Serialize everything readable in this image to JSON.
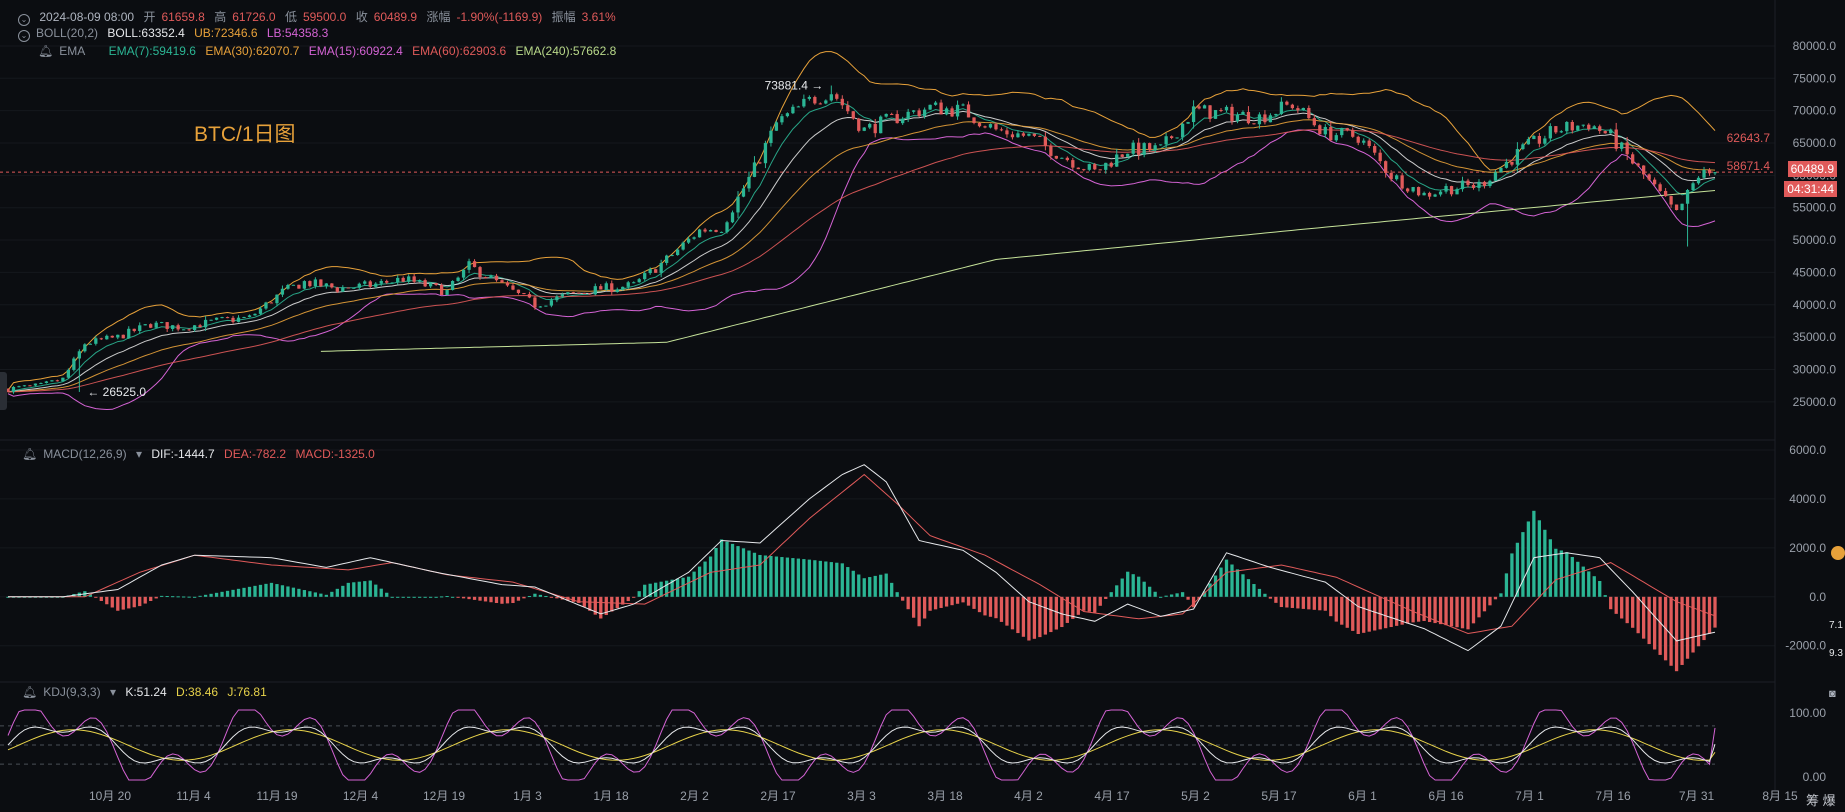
{
  "header": {
    "date": "2024-08-09 08:00",
    "open_label": "开",
    "open": "61659.8",
    "high_label": "高",
    "high": "61726.0",
    "low_label": "低",
    "low": "59500.0",
    "close_label": "收",
    "close": "60489.9",
    "change_label": "涨幅",
    "change": "-1.90%(-1169.9)",
    "amp_label": "振幅",
    "amp": "3.61%"
  },
  "boll": {
    "name": "BOLL(20,2)",
    "mid": "BOLL:63352.4",
    "ub": "UB:72346.6",
    "lb": "LB:54358.3"
  },
  "ema": {
    "name": "EMA",
    "e7": "EMA(7):59419.6",
    "e30": "EMA(30):62070.7",
    "e15": "EMA(15):60922.4",
    "e60": "EMA(60):62903.6",
    "e240": "EMA(240):57662.8"
  },
  "macd": {
    "name": "MACD(12,26,9)",
    "dif": "DIF:-1444.7",
    "dea": "DEA:-782.2",
    "macd": "MACD:-1325.0"
  },
  "kdj": {
    "name": "KDJ(9,3,3)",
    "k": "K:51.24",
    "d": "D:38.46",
    "j": "J:76.81"
  },
  "watermark": "BTC/1日图",
  "price_tags": {
    "ub": "62643.7",
    "lb": "58671.4",
    "last": "60489.9",
    "countdown": "04:31:44"
  },
  "annotations": {
    "high": "73881.4",
    "low": "26525.0"
  },
  "right_edge": {
    "m1": "7.1",
    "m2": "9.3",
    "foot": "筹 爆"
  },
  "colors": {
    "up": "#e05a5a",
    "down": "#2bb594",
    "boll_upper": "#e7a13a",
    "boll_lower": "#d463d4",
    "ema7": "#2bb594",
    "ema15": "#e0e0e0",
    "ema30": "#e7a13a",
    "ema60": "#e05a5a",
    "ema240": "#c6e39a",
    "dif": "#e6e8eb",
    "dea": "#e05a5a",
    "k": "#e6e8eb",
    "d": "#e7d24a",
    "j": "#d463d4"
  },
  "chart_data": [
    {
      "type": "candlestick",
      "title": "BTC/1日图",
      "x_ticks": [
        "10月 20",
        "11月 4",
        "11月 19",
        "12月 4",
        "12月 19",
        "1月 3",
        "1月 18",
        "2月 2",
        "2月 17",
        "3月 3",
        "3月 18",
        "4月 2",
        "4月 17",
        "5月 2",
        "5月 17",
        "6月 1",
        "6月 16",
        "7月 1",
        "7月 16",
        "7月 31",
        "8月 15"
      ],
      "y_ticks": [
        25000,
        30000,
        35000,
        40000,
        45000,
        50000,
        55000,
        60000,
        65000,
        70000,
        75000,
        80000
      ],
      "ylim": [
        22500,
        82000
      ],
      "price_path": [
        [
          0,
          27000
        ],
        [
          6,
          27500
        ],
        [
          10,
          28500
        ],
        [
          14,
          34000
        ],
        [
          20,
          35000
        ],
        [
          26,
          37000
        ],
        [
          32,
          36500
        ],
        [
          38,
          37500
        ],
        [
          44,
          38000
        ],
        [
          50,
          42000
        ],
        [
          54,
          43500
        ],
        [
          60,
          42500
        ],
        [
          66,
          43000
        ],
        [
          72,
          44000
        ],
        [
          80,
          42000
        ],
        [
          84,
          46000
        ],
        [
          90,
          43000
        ],
        [
          96,
          40000
        ],
        [
          102,
          41500
        ],
        [
          108,
          42500
        ],
        [
          114,
          43000
        ],
        [
          120,
          47000
        ],
        [
          126,
          51500
        ],
        [
          130,
          52000
        ],
        [
          136,
          61000
        ],
        [
          140,
          68000
        ],
        [
          146,
          71500
        ],
        [
          150,
          73000
        ],
        [
          156,
          67000
        ],
        [
          162,
          69000
        ],
        [
          168,
          70500
        ],
        [
          174,
          70000
        ],
        [
          180,
          67000
        ],
        [
          186,
          66000
        ],
        [
          192,
          63000
        ],
        [
          198,
          60500
        ],
        [
          204,
          64000
        ],
        [
          210,
          64000
        ],
        [
          216,
          70000
        ],
        [
          222,
          69500
        ],
        [
          228,
          69000
        ],
        [
          234,
          71000
        ],
        [
          240,
          66500
        ],
        [
          246,
          66000
        ],
        [
          252,
          60000
        ],
        [
          258,
          57000
        ],
        [
          262,
          58000
        ],
        [
          268,
          58500
        ],
        [
          276,
          64000
        ],
        [
          282,
          67000
        ],
        [
          288,
          68000
        ],
        [
          292,
          66000
        ],
        [
          300,
          58000
        ],
        [
          304,
          54000
        ],
        [
          308,
          60000
        ],
        [
          311,
          60490
        ]
      ],
      "ema240_path": [
        [
          57,
          32800
        ],
        [
          120,
          34200
        ],
        [
          180,
          47000
        ],
        [
          240,
          52000
        ],
        [
          311,
          57662.8
        ]
      ],
      "boll_last": {
        "ub": 72346.6,
        "mid": 63352.4,
        "lb": 54358.3
      },
      "annotations": [
        {
          "label": "73881.4",
          "x": 150,
          "y": 73881.4
        },
        {
          "label": "26525.0",
          "x": 13,
          "y": 26525.0
        }
      ]
    },
    {
      "type": "bar",
      "title": "MACD(12,26,9)",
      "y_ticks": [
        -2000,
        0,
        2000,
        4000,
        6000
      ],
      "ylim": [
        -3400,
        6000
      ],
      "dif_path": [
        [
          0,
          0
        ],
        [
          10,
          0
        ],
        [
          20,
          300
        ],
        [
          28,
          1300
        ],
        [
          34,
          1700
        ],
        [
          48,
          1600
        ],
        [
          58,
          1200
        ],
        [
          66,
          1600
        ],
        [
          78,
          1000
        ],
        [
          90,
          500
        ],
        [
          96,
          400
        ],
        [
          108,
          -700
        ],
        [
          114,
          -300
        ],
        [
          124,
          1000
        ],
        [
          130,
          2300
        ],
        [
          137,
          2200
        ],
        [
          146,
          4000
        ],
        [
          152,
          5000
        ],
        [
          156,
          5400
        ],
        [
          160,
          4700
        ],
        [
          166,
          2300
        ],
        [
          174,
          1900
        ],
        [
          180,
          1000
        ],
        [
          186,
          -200
        ],
        [
          192,
          -700
        ],
        [
          198,
          -1000
        ],
        [
          204,
          -300
        ],
        [
          210,
          -800
        ],
        [
          216,
          -500
        ],
        [
          222,
          1800
        ],
        [
          230,
          1200
        ],
        [
          240,
          600
        ],
        [
          246,
          -400
        ],
        [
          258,
          -1300
        ],
        [
          266,
          -2200
        ],
        [
          272,
          -1200
        ],
        [
          278,
          1600
        ],
        [
          284,
          1800
        ],
        [
          290,
          1600
        ],
        [
          296,
          200
        ],
        [
          304,
          -1800
        ],
        [
          311,
          -1444.7
        ]
      ],
      "dea_path": [
        [
          0,
          0
        ],
        [
          14,
          0
        ],
        [
          24,
          1000
        ],
        [
          34,
          1700
        ],
        [
          48,
          1300
        ],
        [
          62,
          1100
        ],
        [
          70,
          1400
        ],
        [
          80,
          900
        ],
        [
          92,
          600
        ],
        [
          104,
          -200
        ],
        [
          116,
          -300
        ],
        [
          128,
          1000
        ],
        [
          137,
          1300
        ],
        [
          146,
          3200
        ],
        [
          156,
          5000
        ],
        [
          162,
          3800
        ],
        [
          168,
          2500
        ],
        [
          178,
          1700
        ],
        [
          188,
          500
        ],
        [
          196,
          -600
        ],
        [
          206,
          -900
        ],
        [
          214,
          -700
        ],
        [
          222,
          1000
        ],
        [
          232,
          1300
        ],
        [
          242,
          800
        ],
        [
          256,
          -600
        ],
        [
          266,
          -1500
        ],
        [
          274,
          -1200
        ],
        [
          282,
          700
        ],
        [
          292,
          1400
        ],
        [
          304,
          -200
        ],
        [
          311,
          -782.2
        ]
      ],
      "macd_last": -1325.0
    },
    {
      "type": "line",
      "title": "KDJ(9,3,3)",
      "y_ticks": [
        0,
        100
      ],
      "ylim": [
        -5,
        105
      ],
      "series": [
        {
          "name": "K",
          "last": 51.24
        },
        {
          "name": "D",
          "last": 38.46
        },
        {
          "name": "J",
          "last": 76.81
        }
      ]
    }
  ]
}
